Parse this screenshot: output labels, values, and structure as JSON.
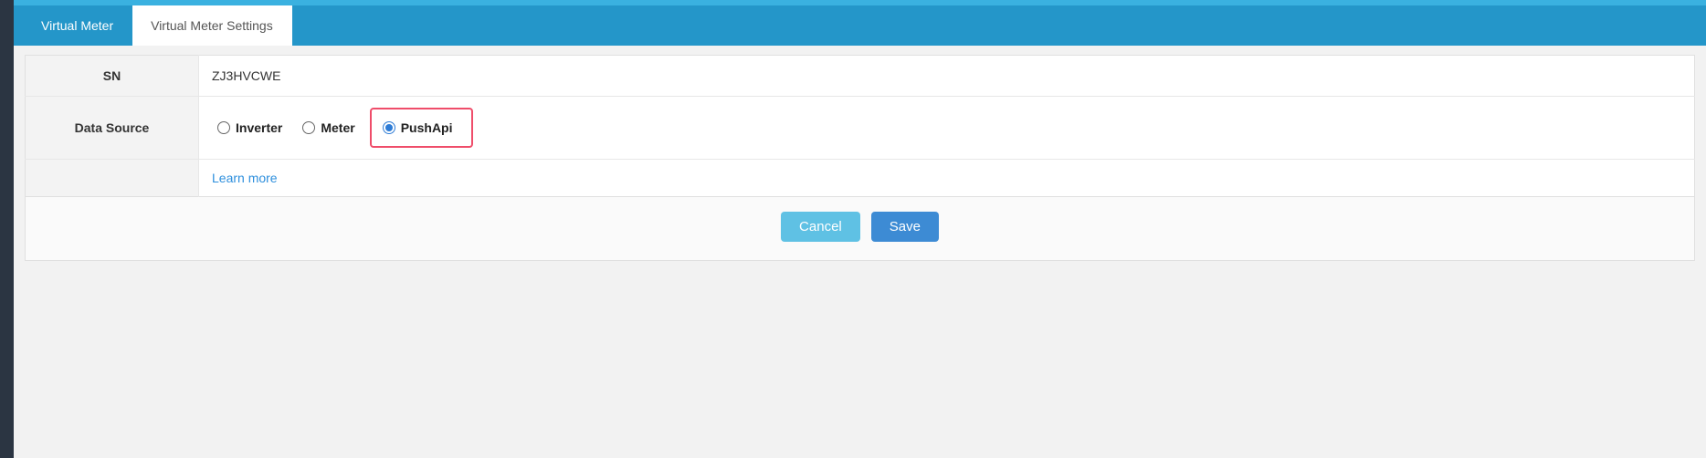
{
  "tabs": {
    "virtual_meter": "Virtual Meter",
    "virtual_meter_settings": "Virtual Meter Settings"
  },
  "form": {
    "sn_label": "SN",
    "sn_value": "ZJ3HVCWE",
    "data_source_label": "Data Source",
    "data_source_options": {
      "inverter": "Inverter",
      "meter": "Meter",
      "pushapi": "PushApi"
    },
    "data_source_selected": "pushapi",
    "learn_more": "Learn more"
  },
  "actions": {
    "cancel": "Cancel",
    "save": "Save"
  }
}
